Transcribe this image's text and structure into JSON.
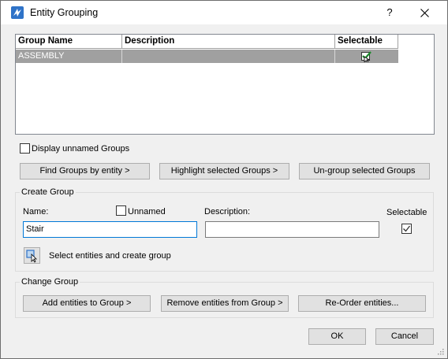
{
  "window": {
    "title": "Entity Grouping",
    "help_label": "?"
  },
  "grid": {
    "columns": [
      "Group Name",
      "Description",
      "Selectable"
    ],
    "rows": [
      {
        "name": "ASSEMBLY",
        "description": "",
        "selectable": true
      }
    ]
  },
  "options": {
    "display_unnamed_label": "Display unnamed Groups",
    "display_unnamed_checked": false
  },
  "actions": {
    "find_label": "Find Groups by entity >",
    "highlight_label": "Highlight selected Groups >",
    "ungroup_label": "Un-group selected Groups"
  },
  "create_group": {
    "title": "Create Group",
    "name_label": "Name:",
    "name_value": "Stair",
    "unnamed_label": "Unnamed",
    "unnamed_checked": false,
    "description_label": "Description:",
    "description_value": "",
    "selectable_label": "Selectable",
    "selectable_checked": true,
    "select_create_label": "Select entities and create group"
  },
  "change_group": {
    "title": "Change Group",
    "add_label": "Add entities to Group >",
    "remove_label": "Remove entities from Group >",
    "reorder_label": "Re-Order entities..."
  },
  "footer": {
    "ok_label": "OK",
    "cancel_label": "Cancel"
  },
  "colors": {
    "focus": "#0078d7",
    "selected_row": "#a0a0a0",
    "check": "#1a8a2a",
    "app_icon": "#2f73c8"
  }
}
